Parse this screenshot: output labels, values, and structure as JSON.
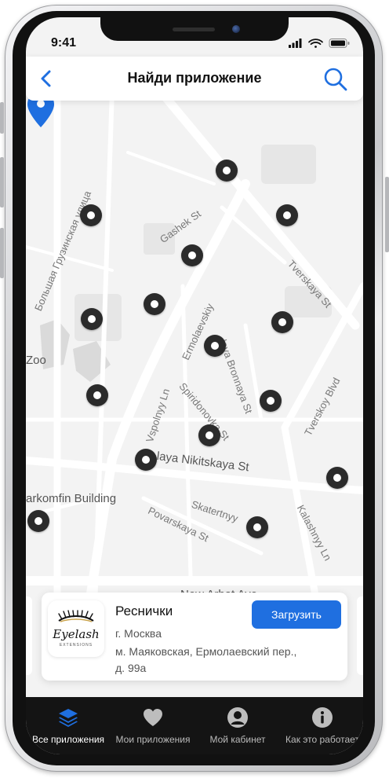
{
  "status_bar": {
    "time": "9:41",
    "icons": [
      "signal-icon",
      "wifi-icon",
      "battery-icon"
    ]
  },
  "header": {
    "title": "Найди приложение",
    "back_icon": "chevron-left-icon",
    "search_icon": "search-icon"
  },
  "colors": {
    "accent": "#1f6fe0",
    "pin": "#2b2b2b",
    "tabbar": "#141414"
  },
  "map": {
    "streets": {
      "gruzinskaya": "Большая Грузинская улица",
      "gashek": "Gashek St",
      "tverskaya": "Tverskaya St",
      "ermolaevskiy": "Ermolaevskiy",
      "bronnaya": "laya Bronnaya St",
      "zoo": "Zoo",
      "spiridonovka": "Spiridonovka St",
      "vspolnyy": "Vspolnyy Ln",
      "tverskoy": "Tverskoy Blvd",
      "nikitskaya": "laya Nikitskaya St",
      "markomfin": "arkomfin Building",
      "skatertnyy": "Skatertnyy",
      "povarskaya": "Povarskaya St",
      "kalashnyy": "Kalashnyy Ln",
      "arbat": "New Arbat Ave"
    }
  },
  "card": {
    "logo_text": "Eyelash",
    "logo_sub": "EXTENSIONS",
    "name": "Реснички",
    "download_label": "Загрузить",
    "city": "г. Москва",
    "address_line1": "м. Маяковская, Ермолаевский пер.,",
    "address_line2": "д. 99а"
  },
  "tabs": [
    {
      "label": "Все приложения",
      "icon": "layers-icon",
      "active": true
    },
    {
      "label": "Мои приложения",
      "icon": "heart-icon",
      "active": false
    },
    {
      "label": "Мой кабинет",
      "icon": "user-icon",
      "active": false
    },
    {
      "label": "Как это работает",
      "icon": "info-icon",
      "active": false
    }
  ]
}
